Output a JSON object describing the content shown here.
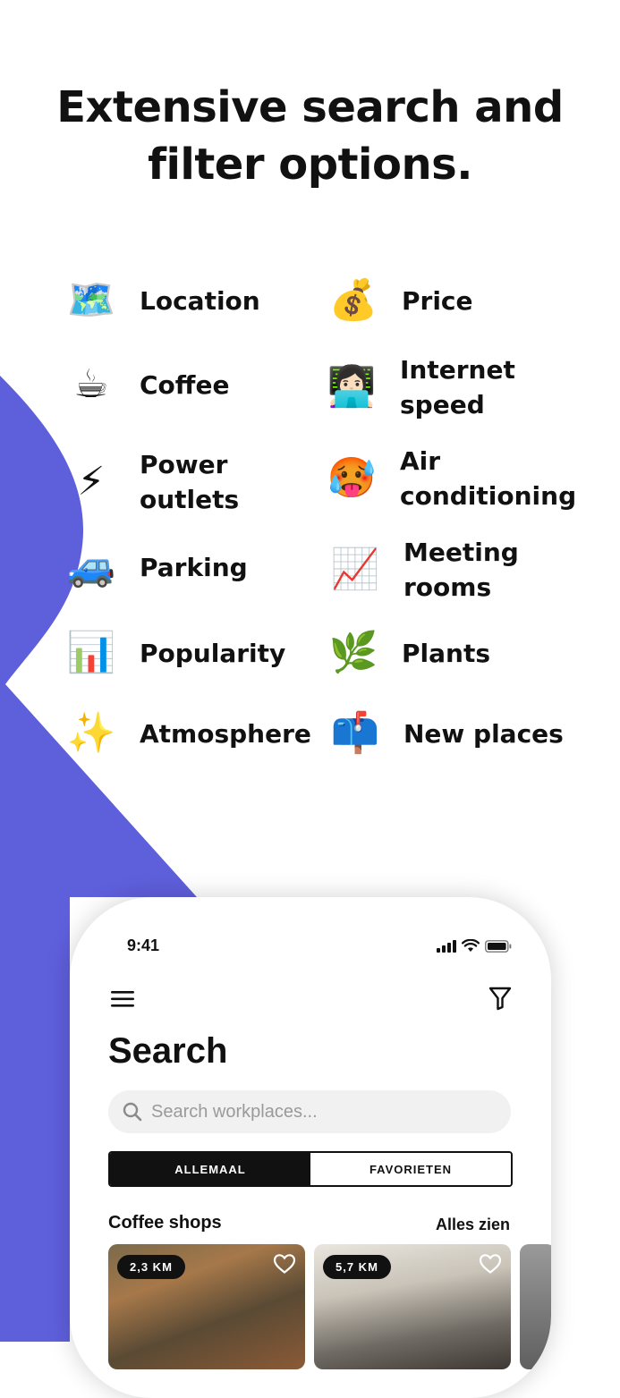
{
  "headline": {
    "line1": "Extensive search and",
    "line2": "filter options."
  },
  "features": [
    {
      "emoji": "🗺️",
      "label": "Location"
    },
    {
      "emoji": "💰",
      "label": "Price"
    },
    {
      "emoji": "☕",
      "label": "Coffee"
    },
    {
      "emoji": "👩🏻‍💻",
      "label": "Internet speed"
    },
    {
      "emoji": "⚡",
      "label": "Power outlets"
    },
    {
      "emoji": "🥵",
      "label": "Air conditioning"
    },
    {
      "emoji": "🚙",
      "label": "Parking"
    },
    {
      "emoji": "📈",
      "label": "Meeting rooms"
    },
    {
      "emoji": "📊",
      "label": "Popularity"
    },
    {
      "emoji": "🌿",
      "label": "Plants"
    },
    {
      "emoji": "✨",
      "label": "Atmosphere"
    },
    {
      "emoji": "📫",
      "label": "New places"
    }
  ],
  "phone": {
    "status_time": "9:41",
    "title": "Search",
    "search_placeholder": "Search workplaces...",
    "tabs": [
      "ALLEMAAL",
      "FAVORIETEN"
    ],
    "active_tab": "ALLEMAAL",
    "section_title": "Coffee shops",
    "see_all": "Alles zien",
    "cards": [
      {
        "distance": "2,3 KM"
      },
      {
        "distance": "5,7 KM"
      }
    ]
  },
  "colors": {
    "accent": "#5e5fdb",
    "text": "#111111"
  }
}
